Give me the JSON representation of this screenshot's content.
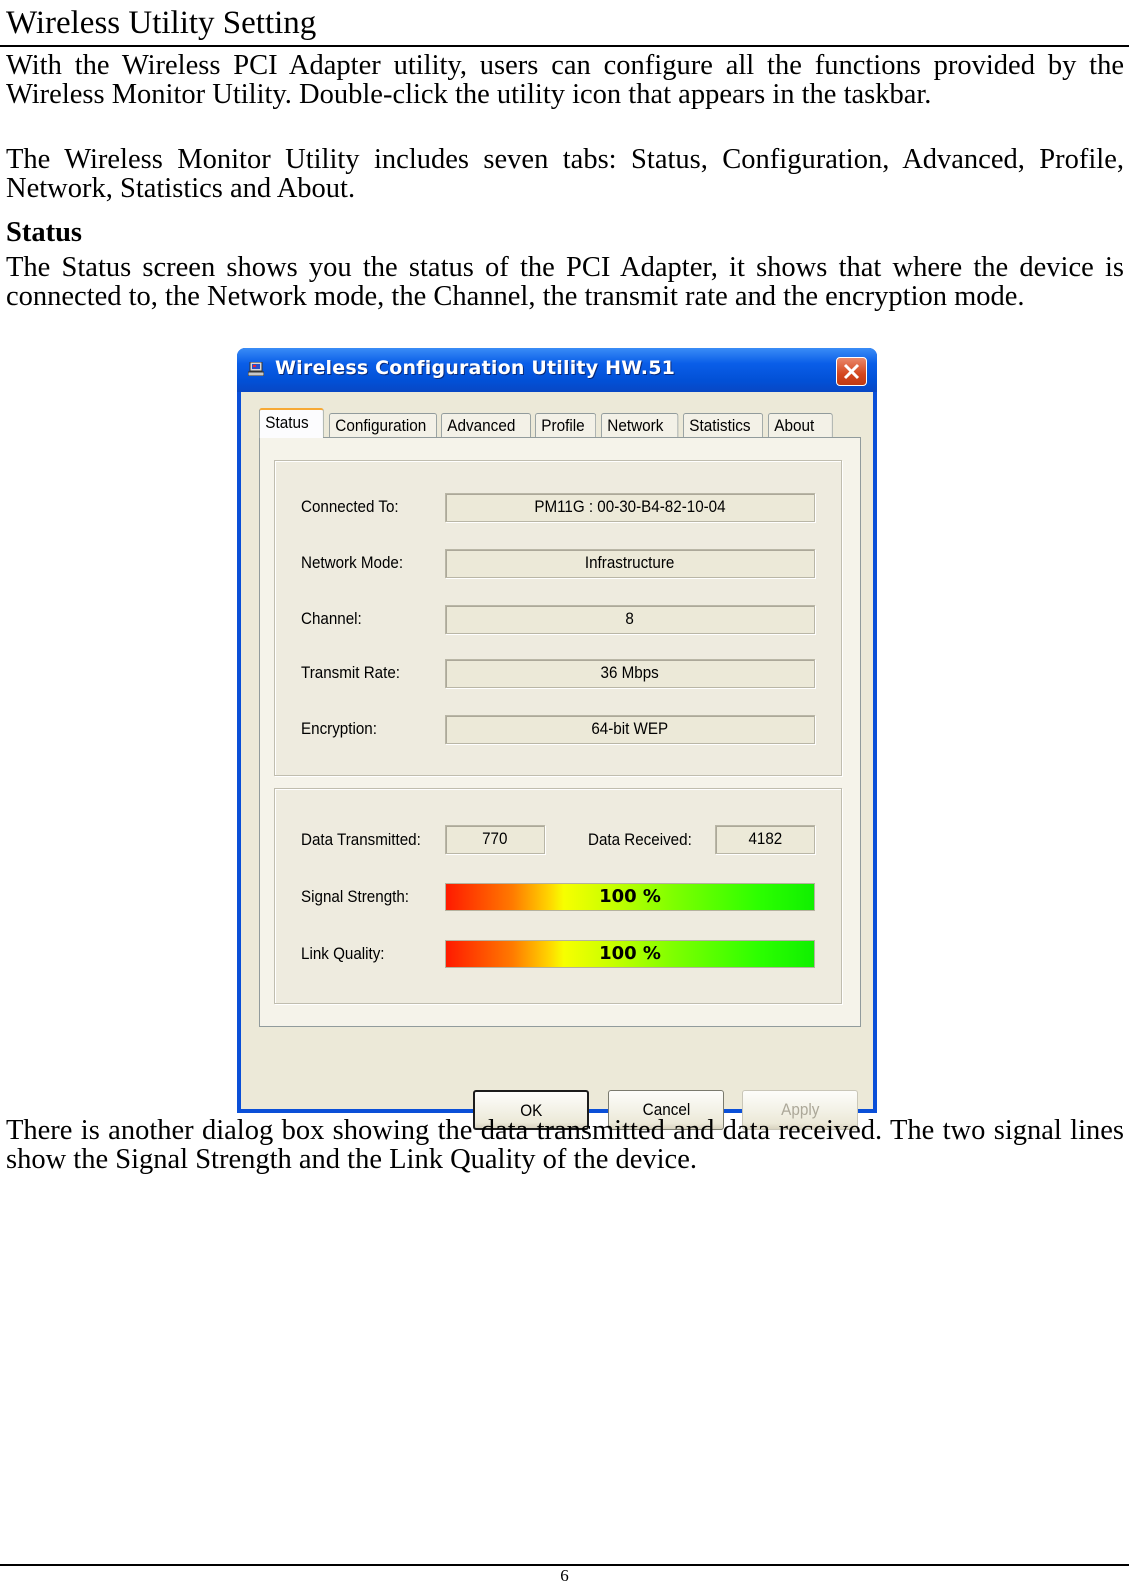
{
  "document": {
    "title": "Wireless Utility Setting",
    "paragraphs": [
      "With the Wireless PCI Adapter utility, users can configure all the functions provided by the Wireless Monitor Utility. Double-click the utility icon that appears in the taskbar.",
      "The Wireless Monitor Utility includes seven tabs: Status, Configuration, Advanced, Profile, Network, Statistics and About."
    ],
    "section_heading": "Status",
    "section_paragraph": "The Status screen shows you the status of the PCI Adapter, it shows that where the device is connected to, the Network mode, the Channel, the transmit rate and the encryption mode.",
    "closing_paragraph": "There is another dialog box showing the data transmitted and data received. The two signal lines show the Signal Strength and the Link Quality of the device.",
    "page_number": "6"
  },
  "dialog": {
    "title": "Wireless Configuration Utility HW.51",
    "icon": "computer-icon",
    "close_icon": "close-icon",
    "tabs": [
      {
        "label": "Status",
        "active": true
      },
      {
        "label": "Configuration",
        "active": false
      },
      {
        "label": "Advanced",
        "active": false
      },
      {
        "label": "Profile",
        "active": false
      },
      {
        "label": "Network",
        "active": false
      },
      {
        "label": "Statistics",
        "active": false
      },
      {
        "label": "About",
        "active": false
      }
    ],
    "status_fields": [
      {
        "label": "Connected To:",
        "value": "PM11G : 00-30-B4-82-10-04"
      },
      {
        "label": "Network Mode:",
        "value": "Infrastructure"
      },
      {
        "label": "Channel:",
        "value": "8"
      },
      {
        "label": "Transmit Rate:",
        "value": "36 Mbps"
      },
      {
        "label": "Encryption:",
        "value": "64-bit WEP"
      }
    ],
    "data_transmitted": {
      "label": "Data Transmitted:",
      "value": "770"
    },
    "data_received": {
      "label": "Data Received:",
      "value": "4182"
    },
    "signal_strength": {
      "label": "Signal Strength:",
      "text": "100 %",
      "percent": 100
    },
    "link_quality": {
      "label": "Link Quality:",
      "text": "100 %",
      "percent": 100
    },
    "buttons": {
      "ok": "OK",
      "cancel": "Cancel",
      "apply": "Apply"
    },
    "colors": {
      "titlebar": "#0a5ee8",
      "close": "#d4461e",
      "face": "#ece9d8",
      "active_tab_accent": "#f7a935"
    }
  }
}
